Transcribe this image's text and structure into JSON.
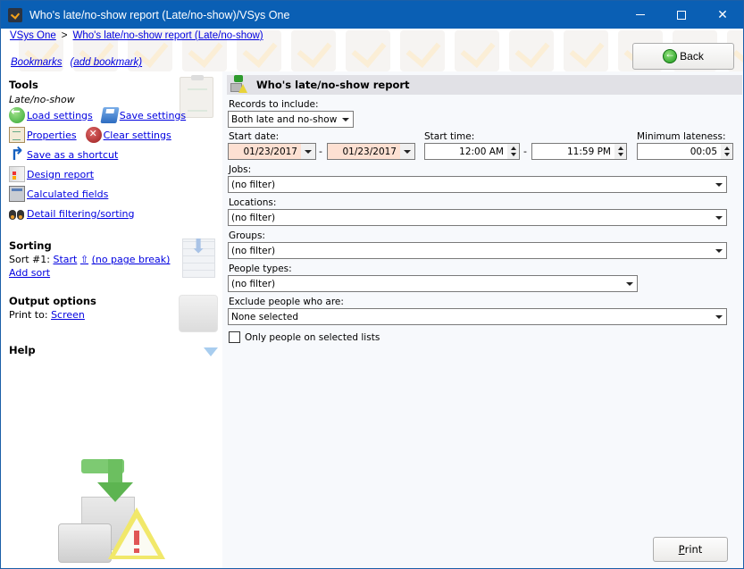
{
  "window": {
    "title": "Who's late/no-show report (Late/no-show)/VSys One",
    "icon": "vsys-checkmark-icon",
    "controls": [
      "minimize",
      "maximize",
      "close"
    ]
  },
  "breadcrumb": {
    "items": [
      "VSys One",
      "Who's late/no-show report (Late/no-show)"
    ],
    "separator": ">"
  },
  "bookmarks": {
    "label": "Bookmarks",
    "add_label": "(add bookmark)"
  },
  "back_button": {
    "label": "Back",
    "icon": "back-arrow-icon"
  },
  "sidebar": {
    "tools": {
      "title": "Tools",
      "subtitle": "Late/no-show",
      "items": [
        {
          "label": "Load settings",
          "icon": "load-settings-icon"
        },
        {
          "label": "Save settings",
          "icon": "save-settings-icon"
        },
        {
          "label": "Properties",
          "icon": "properties-icon"
        },
        {
          "label": "Clear settings",
          "icon": "clear-settings-icon"
        },
        {
          "label": "Save as a shortcut",
          "icon": "shortcut-icon"
        },
        {
          "label": "Design report",
          "icon": "design-report-icon"
        },
        {
          "label": "Calculated fields",
          "icon": "calculator-icon"
        },
        {
          "label": "Detail filtering/sorting",
          "icon": "binoculars-icon"
        }
      ]
    },
    "sorting": {
      "title": "Sorting",
      "sort_prefix": "Sort #1:",
      "sort_field": "Start",
      "sort_direction_glyph": "⇧",
      "page_break": "(no page break)",
      "add_sort": "Add sort"
    },
    "output": {
      "title": "Output options",
      "print_to_label": "Print to:",
      "print_to_value": "Screen"
    },
    "help": {
      "title": "Help"
    }
  },
  "report": {
    "title": "Who's late/no-show report",
    "records_label": "Records to include:",
    "records_value": "Both late and no-show",
    "start_date_label": "Start date:",
    "start_date_from": "01/23/2017",
    "start_date_to": "01/23/2017",
    "start_time_label": "Start time:",
    "start_time_from": "12:00 AM",
    "start_time_to": "11:59 PM",
    "range_separator": "-",
    "min_lateness_label": "Minimum lateness:",
    "min_lateness_value": "00:05",
    "jobs_label": "Jobs:",
    "jobs_value": "(no filter)",
    "locations_label": "Locations:",
    "locations_value": "(no filter)",
    "groups_label": "Groups:",
    "groups_value": "(no filter)",
    "people_types_label": "People types:",
    "people_types_value": "(no filter)",
    "exclude_label": "Exclude people who are:",
    "exclude_value": "None selected",
    "only_selected_lists_label": "Only people on selected lists",
    "only_selected_lists_checked": false,
    "print_button_first": "P",
    "print_button_rest": "rint"
  }
}
